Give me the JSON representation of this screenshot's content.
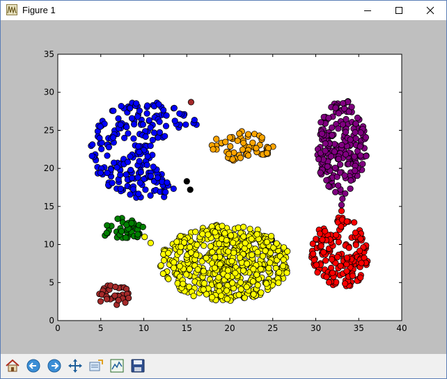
{
  "window": {
    "title": "Figure 1"
  },
  "toolbar": {
    "buttons": [
      {
        "name": "home-button",
        "icon": "home-icon"
      },
      {
        "name": "back-button",
        "icon": "back-arrow-icon"
      },
      {
        "name": "forward-button",
        "icon": "forward-arrow-icon"
      },
      {
        "name": "pan-button",
        "icon": "move-arrows-icon"
      },
      {
        "name": "zoom-button",
        "icon": "zoom-rect-icon"
      },
      {
        "name": "subplots-button",
        "icon": "configure-subplots-icon"
      },
      {
        "name": "save-button",
        "icon": "floppy-disk-icon"
      }
    ]
  },
  "chart_data": {
    "type": "scatter",
    "title": "",
    "xlabel": "",
    "ylabel": "",
    "xlim": [
      0,
      40
    ],
    "ylim": [
      0,
      35
    ],
    "xticks": [
      0,
      5,
      10,
      15,
      20,
      25,
      30,
      35,
      40
    ],
    "yticks": [
      0,
      5,
      10,
      15,
      20,
      25,
      30,
      35
    ],
    "grid": false,
    "legend": false,
    "clusters": [
      {
        "color": "#0000ff",
        "shape": "crescent",
        "cx": 10.5,
        "cy": 22.5,
        "rx": 6.8,
        "ry": 6.5,
        "count": 230
      },
      {
        "color": "#ffa500",
        "shape": "ellipse",
        "cx": 21.5,
        "cy": 23.0,
        "rx": 3.6,
        "ry": 2.1,
        "count": 60
      },
      {
        "color": "#800080",
        "shape": "ellipse",
        "cx": 33.0,
        "cy": 22.8,
        "rx": 3.0,
        "ry": 6.3,
        "count": 210
      },
      {
        "color": "#008000",
        "shape": "ellipse",
        "cx": 7.5,
        "cy": 11.8,
        "rx": 2.3,
        "ry": 1.7,
        "count": 40
      },
      {
        "color": "#ffff00",
        "shape": "ellipse",
        "cx": 19.5,
        "cy": 7.6,
        "rx": 7.6,
        "ry": 5.0,
        "count": 560
      },
      {
        "color": "#ff0000",
        "shape": "ellipse",
        "cx": 32.8,
        "cy": 8.8,
        "rx": 3.3,
        "ry": 4.8,
        "count": 170
      },
      {
        "color": "#a52a2a",
        "shape": "ellipse",
        "cx": 6.5,
        "cy": 3.3,
        "rx": 2.0,
        "ry": 1.4,
        "count": 30
      }
    ],
    "extra_points": [
      {
        "x": 15.5,
        "y": 28.7,
        "color": "#a52a2a"
      },
      {
        "x": 15.0,
        "y": 18.3,
        "color": "#000000"
      },
      {
        "x": 15.4,
        "y": 17.2,
        "color": "#000000"
      },
      {
        "x": 33.1,
        "y": 16.0,
        "color": "#800080"
      },
      {
        "x": 33.0,
        "y": 15.2,
        "color": "#800080"
      },
      {
        "x": 33.0,
        "y": 14.4,
        "color": "#ff0000"
      },
      {
        "x": 10.1,
        "y": 11.0,
        "color": "#ffff00"
      },
      {
        "x": 10.8,
        "y": 10.2,
        "color": "#ffff00"
      },
      {
        "x": 9.9,
        "y": 12.3,
        "color": "#008000"
      }
    ]
  }
}
